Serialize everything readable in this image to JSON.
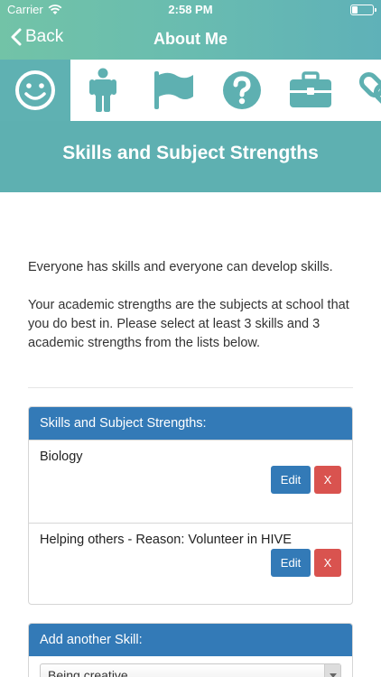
{
  "status_bar": {
    "carrier": "Carrier",
    "time": "2:58 PM"
  },
  "nav": {
    "back_label": "Back",
    "title": "About Me"
  },
  "tabs": [
    {
      "icon": "smiley-icon",
      "active": true
    },
    {
      "icon": "person-icon",
      "active": false
    },
    {
      "icon": "flag-icon",
      "active": false
    },
    {
      "icon": "question-icon",
      "active": false
    },
    {
      "icon": "briefcase-icon",
      "active": false
    },
    {
      "icon": "link-icon",
      "active": false
    }
  ],
  "section": {
    "title": "Skills and Subject Strengths"
  },
  "intro": {
    "paragraph1": "Everyone has skills and everyone can develop skills.",
    "paragraph2": "Your academic strengths are the subjects at school that you do best in. Please select at least 3 skills and 3 academic strengths from the lists below."
  },
  "strengths_panel": {
    "heading": "Skills and Subject Strengths:",
    "items": [
      {
        "label": "Biology",
        "edit_label": "Edit",
        "delete_label": "X"
      },
      {
        "label": "Helping others - Reason: Volunteer in HIVE",
        "edit_label": "Edit",
        "delete_label": "X"
      }
    ]
  },
  "add_skill_panel": {
    "heading": "Add another Skill:",
    "selected": "Being creative"
  },
  "colors": {
    "brand": "#5fb1b2",
    "primary": "#337ab7",
    "danger": "#d9534f"
  }
}
